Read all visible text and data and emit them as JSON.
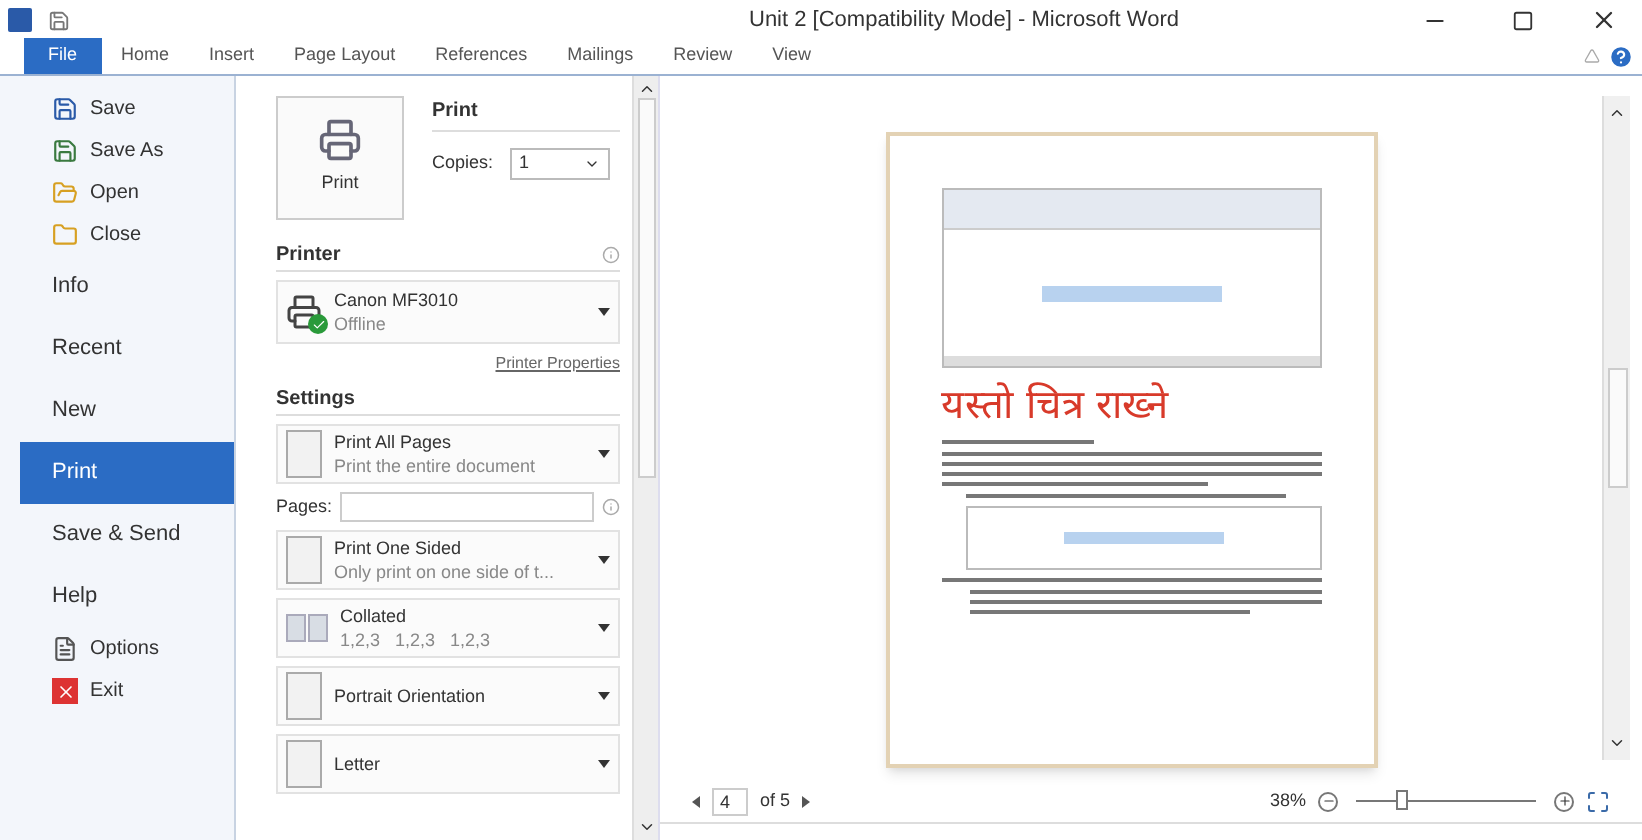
{
  "window": {
    "title": "Unit 2 [Compatibility Mode] - Microsoft Word"
  },
  "tabs": [
    {
      "label": "File",
      "selected": true
    },
    {
      "label": "Home",
      "selected": false
    },
    {
      "label": "Insert",
      "selected": false
    },
    {
      "label": "Page Layout",
      "selected": false
    },
    {
      "label": "References",
      "selected": false
    },
    {
      "label": "Mailings",
      "selected": false
    },
    {
      "label": "Review",
      "selected": false
    },
    {
      "label": "View",
      "selected": false
    }
  ],
  "nav": [
    {
      "label": "Save",
      "kind": "command",
      "selected": false
    },
    {
      "label": "Save As",
      "kind": "command",
      "selected": false
    },
    {
      "label": "Open",
      "kind": "command",
      "selected": false
    },
    {
      "label": "Close",
      "kind": "command",
      "selected": false
    },
    {
      "label": "Info",
      "kind": "page",
      "selected": false
    },
    {
      "label": "Recent",
      "kind": "page",
      "selected": false
    },
    {
      "label": "New",
      "kind": "page",
      "selected": false
    },
    {
      "label": "Print",
      "kind": "page",
      "selected": true
    },
    {
      "label": "Save & Send",
      "kind": "page",
      "selected": false
    },
    {
      "label": "Help",
      "kind": "page",
      "selected": false
    },
    {
      "label": "Options",
      "kind": "command",
      "selected": false
    },
    {
      "label": "Exit",
      "kind": "command",
      "selected": false
    }
  ],
  "print": {
    "button": "Print",
    "heading": "Print",
    "copies_label": "Copies:",
    "copies": "1"
  },
  "printer": {
    "heading": "Printer",
    "name": "Canon MF3010",
    "status": "Offline",
    "properties": "Printer Properties"
  },
  "settings": {
    "heading": "Settings",
    "items": [
      {
        "kind": "dropdown",
        "title": "Print All Pages",
        "subtitle": "Print the entire document"
      },
      {
        "kind": "pages_field",
        "label": "Pages:"
      },
      {
        "kind": "dropdown",
        "title": "Print One Sided",
        "subtitle": "Only print on one side of t..."
      },
      {
        "kind": "dropdown",
        "title": "Collated",
        "subtitle": "1,2,3   1,2,3   1,2,3"
      },
      {
        "kind": "dropdown",
        "title": "Portrait Orientation"
      },
      {
        "kind": "dropdown",
        "title": "Letter"
      }
    ]
  },
  "preview": {
    "heading": "यस्तो चित्र राख्ने",
    "page": "4",
    "page_total": "of 5",
    "zoom": "38%",
    "level": 0.26
  }
}
